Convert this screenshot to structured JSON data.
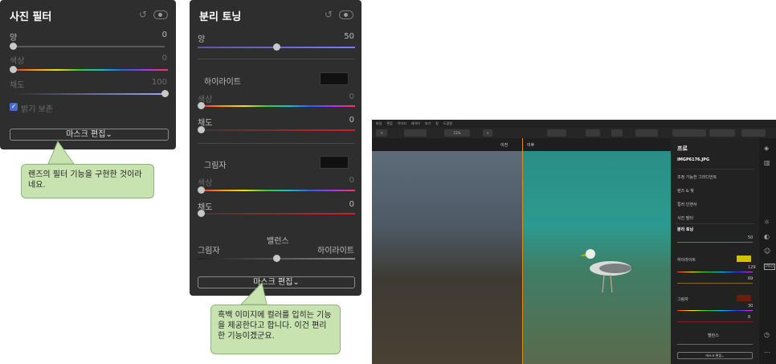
{
  "photo_filter_panel": {
    "title": "사진 필터",
    "amount_label": "양",
    "amount_value": "0",
    "hue_label": "색상",
    "hue_value": "0",
    "saturation_label": "채도",
    "saturation_value": "100",
    "preserve_brightness_label": "밝기 보존",
    "preserve_brightness_checked": true,
    "mask_button": "마스크 편집⌄"
  },
  "split_toning_panel": {
    "title": "분리 토닝",
    "amount_label": "양",
    "amount_value": "50",
    "highlights_label": "하이라이트",
    "highlights_hue_label": "색상",
    "highlights_hue_value": "0",
    "highlights_sat_label": "채도",
    "highlights_sat_value": "0",
    "shadows_label": "그림자",
    "shadows_hue_label": "색상",
    "shadows_hue_value": "0",
    "shadows_sat_label": "채도",
    "shadows_sat_value": "0",
    "balance_label": "밸런스",
    "balance_left": "그림자",
    "balance_right": "하이라이트",
    "mask_button": "마스크 편집⌄"
  },
  "callouts": {
    "first": "렌즈의 필터 기능을 구현한 것이라네요.",
    "second": "흑백 이미지에 컬러를 입히는 기능을 제공한다고 합니다. 이건 편리한 기능이겠군요."
  },
  "app": {
    "menu": [
      "파일",
      "편집",
      "이미지",
      "레이어",
      "보기",
      "창",
      "도움말"
    ],
    "zoom": "21%",
    "before_label": "이전",
    "after_label": "이후",
    "sidebar_title": "프로",
    "file_name": "IMGP6176.JPG",
    "tool_items": [
      "조정 가능한 그라디언트",
      "렌즈 & 빛",
      "컬러 인핸서",
      "사진 필터"
    ],
    "split_toning_title": "분리 토닝",
    "amount_value": "50",
    "highlights": "하이라이트",
    "highlights_hue_value": "129",
    "highlights_sat_value": "69",
    "shadows": "그림자",
    "shadows_hue_value": "30",
    "shadows_sat_value": "8",
    "balance": "밸런스",
    "mask_button": "마스크 편집⌄",
    "colors": {
      "highlight_swatch": "#d4c000",
      "shadow_swatch": "#6a1e0a",
      "split_line": "#e08a20"
    }
  }
}
